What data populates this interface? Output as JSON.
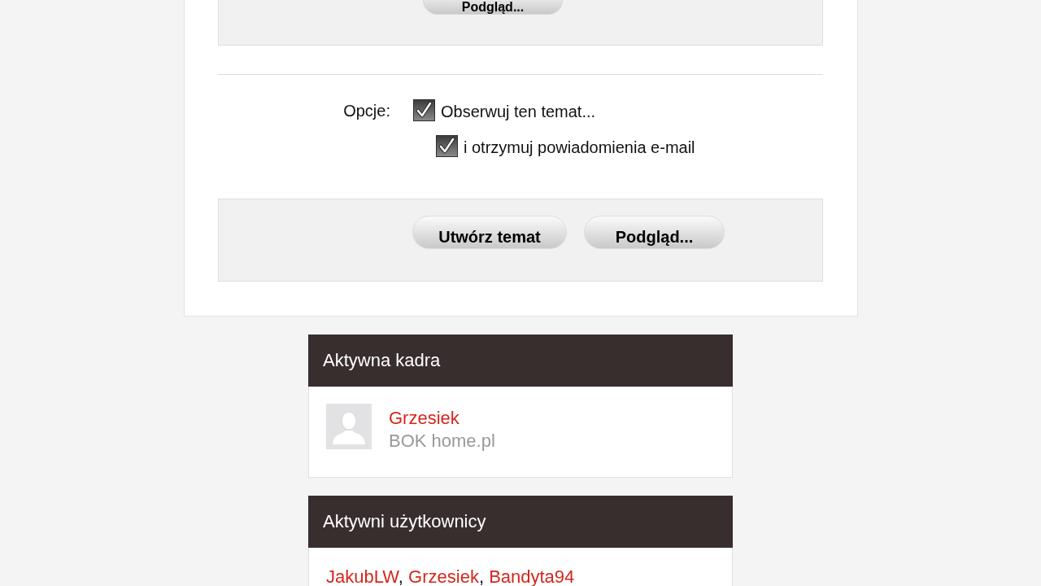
{
  "top_panel": {
    "buttons": [
      {
        "label": "Podgląd..."
      }
    ]
  },
  "options": {
    "label": "Opcje:",
    "items": [
      {
        "label": "Obserwuj ten temat...",
        "checked": true,
        "children": [
          {
            "label": "i otrzymuj powiadomienia e-mail",
            "checked": true
          }
        ]
      }
    ]
  },
  "actions": {
    "buttons": [
      {
        "label": "Utwórz temat"
      },
      {
        "label": "Podgląd..."
      }
    ]
  },
  "active_staff": {
    "title": "Aktywna kadra",
    "members": [
      {
        "name": "Grzesiek",
        "role": "BOK home.pl"
      }
    ]
  },
  "active_users": {
    "title": "Aktywni użytkownicy",
    "separator": ",",
    "users": [
      "JakubLW",
      "Grzesiek",
      "Bandyta94"
    ]
  }
}
